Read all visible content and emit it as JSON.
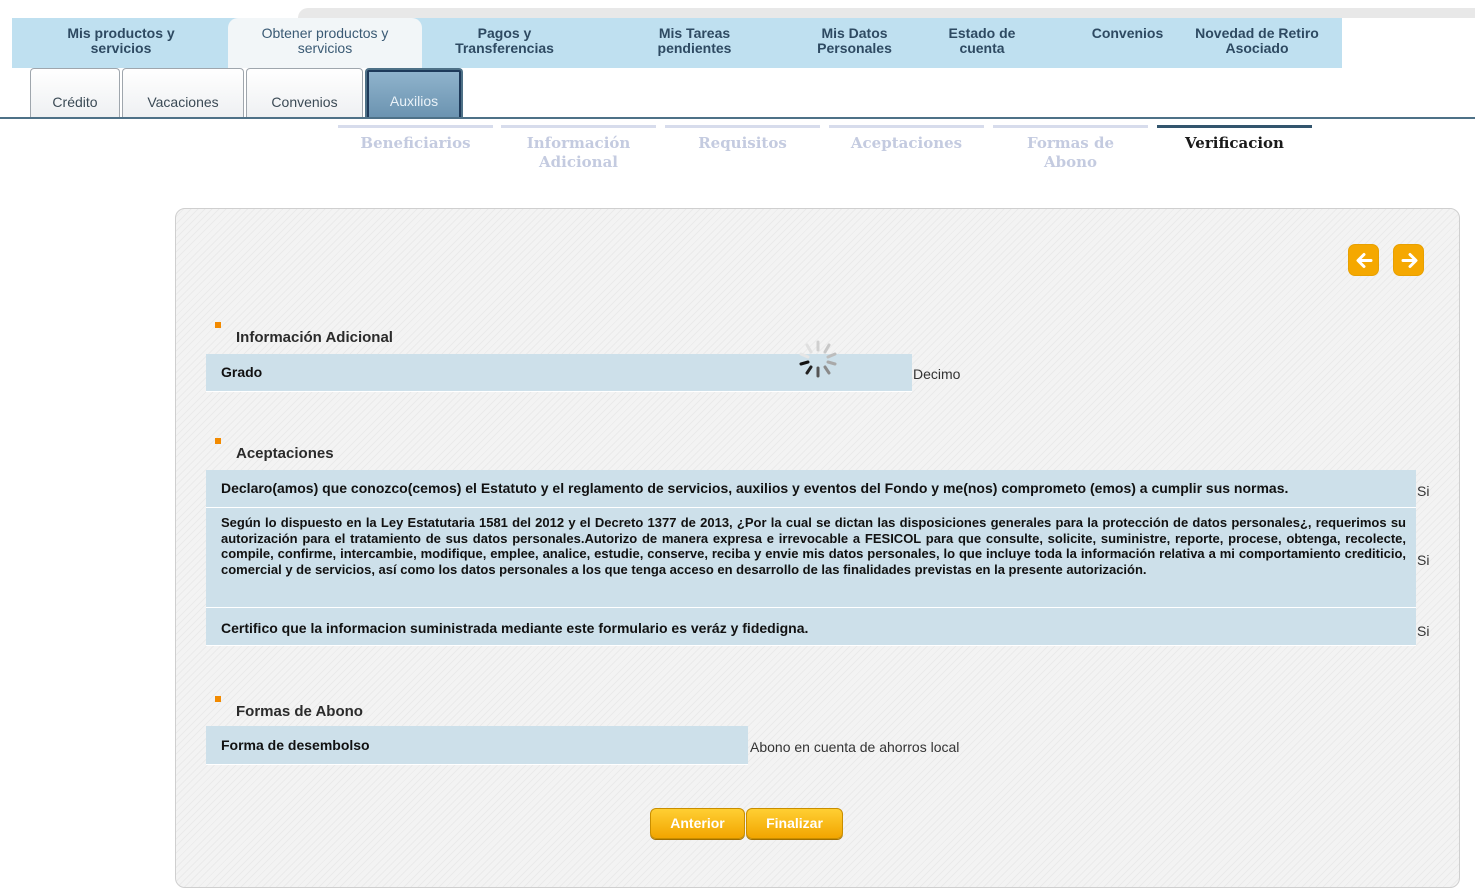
{
  "main_nav": [
    {
      "label": "Mis productos y servicios"
    },
    {
      "label": "Obtener productos y servicios"
    },
    {
      "label": "Pagos y Transferencias"
    },
    {
      "label": "Mis Tareas pendientes"
    },
    {
      "label": "Mis Datos Personales"
    },
    {
      "label": "Estado de cuenta"
    },
    {
      "label": "Convenios"
    },
    {
      "label": "Novedad de Retiro Asociado"
    }
  ],
  "sub_tabs": [
    {
      "label": "Crédito"
    },
    {
      "label": "Vacaciones"
    },
    {
      "label": "Convenios"
    },
    {
      "label": "Auxilios"
    }
  ],
  "steps": [
    {
      "label": "Beneficiarios"
    },
    {
      "label": "Información Adicional"
    },
    {
      "label": "Requisitos"
    },
    {
      "label": "Aceptaciones"
    },
    {
      "label": "Formas de Abono"
    },
    {
      "label": "Verificacion"
    }
  ],
  "info_adicional": {
    "title": "Información Adicional",
    "label": "Grado",
    "value": "Decimo"
  },
  "aceptaciones": {
    "title": "Aceptaciones",
    "items": [
      {
        "text": "Declaro(amos) que conozco(cemos) el Estatuto y el reglamento de servicios, auxilios y eventos del Fondo y me(nos) comprometo (emos) a cumplir sus normas.",
        "value": "Si"
      },
      {
        "text": "Según lo dispuesto en la Ley Estatutaria 1581 del 2012 y el Decreto 1377 de 2013, ¿Por la cual se dictan las disposiciones generales para la protección de datos personales¿, requerimos su autorización para el tratamiento de sus datos personales.Autorizo de manera expresa e irrevocable a FESICOL para que consulte, solicite, suministre, reporte, procese, obtenga, recolecte, compile, confirme, intercambie, modifique, emplee, analice, estudie, conserve, reciba y envie mis datos personales, lo que incluye toda la información relativa a mi comportamiento crediticio, comercial y de servicios, así como los datos personales a los que tenga acceso en desarrollo de las finalidades previstas en la presente autorización.",
        "value": "Si"
      },
      {
        "text": "Certifico que la informacion suministrada mediante este formulario es veráz y fidedigna.",
        "value": "Si"
      }
    ]
  },
  "formas_abono": {
    "title": "Formas de Abono",
    "label": "Forma de desembolso",
    "value": "Abono en cuenta de ahorros local"
  },
  "buttons": {
    "anterior": "Anterior",
    "finalizar": "Finalizar"
  },
  "icons": {
    "prev": "arrow-left-icon",
    "next": "arrow-right-icon",
    "loading": "spinner-icon"
  },
  "colors": {
    "nav_bg": "#bfe0f0",
    "row_bg": "#cde0ea",
    "accent": "#f5a800",
    "marker": "#f28a00"
  }
}
